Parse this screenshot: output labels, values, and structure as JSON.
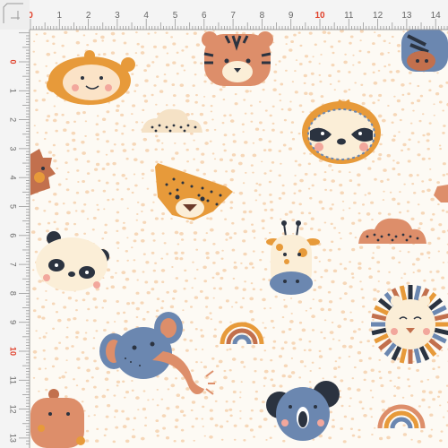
{
  "colors": {
    "fabric": "#fdfaf4",
    "dots": "#f6d7b8",
    "ruler": "#f4f4f4",
    "ruler_line": "#9a9a9a",
    "accent_red": "#e0402a",
    "orange": "#e79a3a",
    "peach": "#dd8e6a",
    "blue": "#6b87b0",
    "navy": "#2b3340",
    "cream": "#fbeed7",
    "rust": "#c2704d"
  },
  "ruler_top": {
    "labels": [
      "0",
      "1",
      "2",
      "3",
      "4",
      "5",
      "6",
      "7",
      "8",
      "9",
      "10",
      "11",
      "12",
      "13",
      "14"
    ],
    "highlight": [
      "0",
      "10"
    ]
  },
  "ruler_left": {
    "labels": [
      "0",
      "1",
      "2",
      "3",
      "4",
      "5",
      "6",
      "7",
      "8",
      "9",
      "10",
      "11",
      "12",
      "13"
    ],
    "highlight": [
      "0",
      "10"
    ]
  },
  "motifs": [
    {
      "name": "monkey-face-icon"
    },
    {
      "name": "tiger-face-icon"
    },
    {
      "name": "zebra-face-icon"
    },
    {
      "name": "cloud-icon"
    },
    {
      "name": "sloth-face-icon"
    },
    {
      "name": "hedgehog-icon"
    },
    {
      "name": "cheetah-face-icon"
    },
    {
      "name": "panda-face-icon"
    },
    {
      "name": "giraffe-face-icon"
    },
    {
      "name": "cloud-icon"
    },
    {
      "name": "lion-face-icon"
    },
    {
      "name": "rainbow-icon"
    },
    {
      "name": "elephant-face-icon"
    },
    {
      "name": "koala-face-icon"
    },
    {
      "name": "rainbow-icon"
    },
    {
      "name": "hippo-face-icon"
    }
  ]
}
